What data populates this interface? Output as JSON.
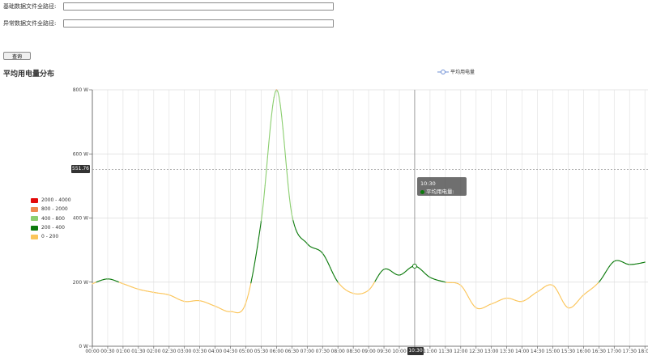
{
  "form": {
    "base_label": "基础数据文件全路径:",
    "base_value": "",
    "abnormal_label": "异常数据文件全路径:",
    "abnormal_value": "",
    "query_label": "查询"
  },
  "chart_data": {
    "type": "line",
    "title": "平均用电量分布",
    "legend": "平均用电量",
    "x": [
      "00:00",
      "00:30",
      "01:00",
      "01:30",
      "02:00",
      "02:30",
      "03:00",
      "03:30",
      "04:00",
      "04:30",
      "05:00",
      "05:30",
      "06:00",
      "06:30",
      "07:00",
      "07:30",
      "08:00",
      "08:30",
      "09:00",
      "09:30",
      "10:00",
      "10:30",
      "11:00",
      "11:30",
      "12:00",
      "12:30",
      "13:00",
      "13:30",
      "14:00",
      "14:30",
      "15:00",
      "15:30",
      "16:00",
      "16:30",
      "17:00",
      "17:30",
      "18:00"
    ],
    "y": [
      195,
      210,
      195,
      178,
      168,
      160,
      140,
      142,
      125,
      108,
      135,
      390,
      800,
      410,
      320,
      290,
      200,
      165,
      175,
      240,
      222,
      250,
      215,
      200,
      190,
      120,
      132,
      150,
      140,
      170,
      190,
      120,
      160,
      200,
      265,
      255,
      262
    ],
    "y_ticks": [
      "0 W",
      "200 W",
      "400 W",
      "600 W",
      "800 W"
    ],
    "ylim": [
      0,
      800
    ],
    "grid": true,
    "visual_map": [
      {
        "label": "2000 - 4000",
        "color": "#e30a0a"
      },
      {
        "label": "800 - 2000",
        "color": "#ef8a50"
      },
      {
        "label": "400 - 800",
        "color": "#8bce6f"
      },
      {
        "label": "200 - 400",
        "color": "#0c7a0c"
      },
      {
        "label": "0 - 200",
        "color": "#fbc55a"
      }
    ],
    "axis_pointer": {
      "x": "10:30",
      "y": "551.76"
    },
    "tooltip": {
      "title": "10:30",
      "series": "平均用电量",
      "value": "250"
    }
  }
}
